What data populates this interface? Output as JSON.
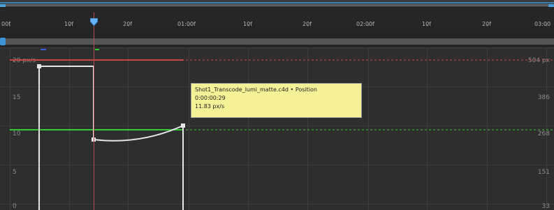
{
  "ruler": {
    "labels": [
      "00f",
      "10f",
      "20f",
      "01:00f",
      "10f",
      "20f",
      "02:00f",
      "10f",
      "20f",
      "03:00"
    ]
  },
  "graph": {
    "velocity_labels": [
      "20 px/s",
      "15",
      "10",
      "5",
      "0"
    ],
    "value_labels": [
      "504 px",
      "386",
      "268",
      "151",
      "33"
    ]
  },
  "tooltip": {
    "layer_property": "Shot1_Transcode_lumi_matte.c4d • Position",
    "time": "0:00:00:29",
    "speed": "11.83 px/s"
  },
  "colors": {
    "curve": "#e6e6e6",
    "green_curve": "#37c837",
    "red_curve": "#c84646",
    "cti": "#b84a4a",
    "cti_marker": "#6ab4ff",
    "tooltip_bg": "#f5f196"
  }
}
